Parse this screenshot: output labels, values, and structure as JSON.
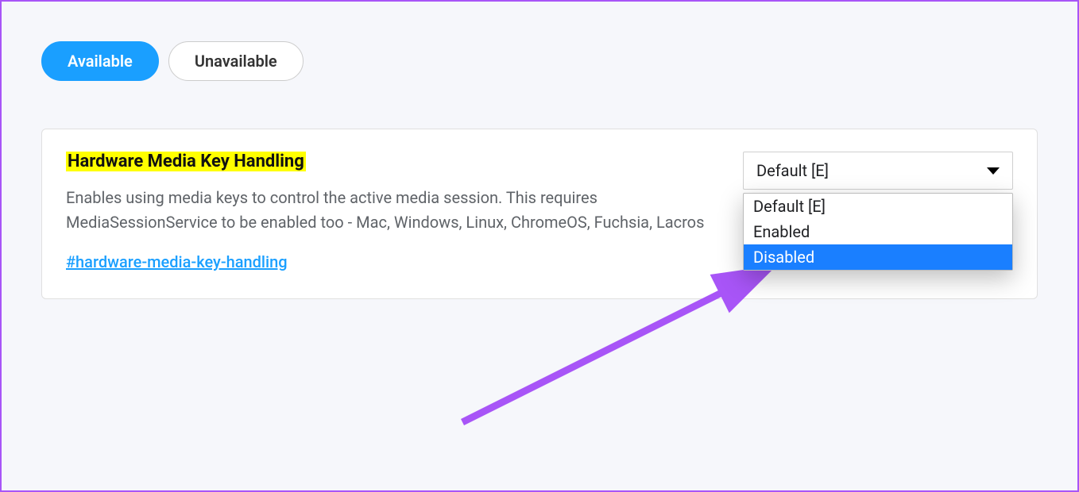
{
  "tabs": {
    "available": "Available",
    "unavailable": "Unavailable"
  },
  "flag": {
    "title": "Hardware Media Key Handling",
    "description": "Enables using media keys to control the active media session. This requires MediaSessionService to be enabled too - Mac, Windows, Linux, ChromeOS, Fuchsia, Lacros",
    "link": "#hardware-media-key-handling"
  },
  "dropdown": {
    "selected": "Default [E]",
    "options": {
      "default": "Default [E]",
      "enabled": "Enabled",
      "disabled": "Disabled"
    }
  },
  "annotation": {
    "arrow_color": "#a855f7"
  }
}
